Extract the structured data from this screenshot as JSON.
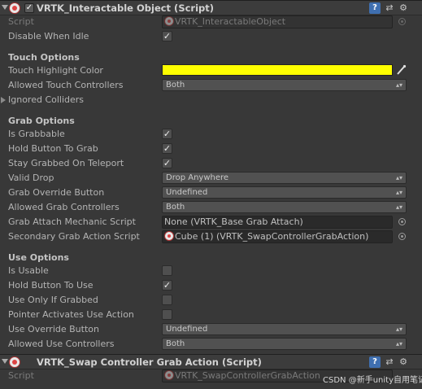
{
  "component1": {
    "title": "VRTK_Interactable Object (Script)",
    "script_label": "Script",
    "script_value": "VRTK_InteractableObject",
    "disable_when_idle_label": "Disable When Idle",
    "disable_when_idle": true
  },
  "touch": {
    "section": "Touch Options",
    "highlight_label": "Touch Highlight Color",
    "highlight_color": "#ffff00",
    "allowed_controllers_label": "Allowed Touch Controllers",
    "allowed_controllers": "Both",
    "ignored_colliders_label": "Ignored Colliders"
  },
  "grab": {
    "section": "Grab Options",
    "is_grabbable_label": "Is Grabbable",
    "is_grabbable": true,
    "hold_button_label": "Hold Button To Grab",
    "hold_button": true,
    "stay_grabbed_label": "Stay Grabbed On Teleport",
    "stay_grabbed": true,
    "valid_drop_label": "Valid Drop",
    "valid_drop": "Drop Anywhere",
    "override_button_label": "Grab Override Button",
    "override_button": "Undefined",
    "allowed_controllers_label": "Allowed Grab Controllers",
    "allowed_controllers": "Both",
    "attach_mechanic_label": "Grab Attach Mechanic Script",
    "attach_mechanic": "None (VRTK_Base Grab Attach)",
    "secondary_action_label": "Secondary Grab Action Script",
    "secondary_action": "Cube (1) (VRTK_SwapControllerGrabAction)"
  },
  "use": {
    "section": "Use Options",
    "is_usable_label": "Is Usable",
    "is_usable": false,
    "hold_button_label": "Hold Button To Use",
    "hold_button": true,
    "only_if_grabbed_label": "Use Only If Grabbed",
    "only_if_grabbed": false,
    "pointer_activates_label": "Pointer Activates Use Action",
    "pointer_activates": false,
    "override_button_label": "Use Override Button",
    "override_button": "Undefined",
    "allowed_controllers_label": "Allowed Use Controllers",
    "allowed_controllers": "Both"
  },
  "component2": {
    "title": "VRTK_Swap Controller Grab Action (Script)",
    "script_label": "Script",
    "script_value": "VRTK_SwapControllerGrabAction"
  },
  "glyphs": {
    "check": "✓",
    "help": "?",
    "preset": "⇄",
    "gear": "⚙",
    "dropdown_arrows": "▴▾",
    "eyedropper": "⁄"
  },
  "watermark": "CSDN @新手unity自用笔记"
}
